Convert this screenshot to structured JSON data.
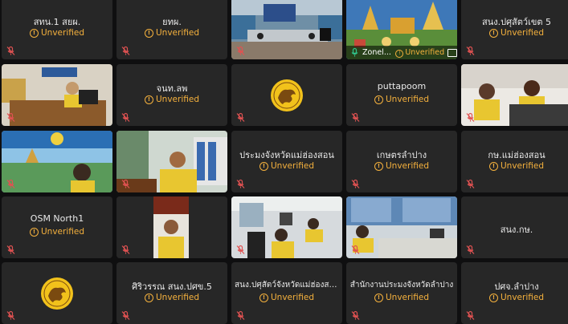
{
  "status_label": "Unverified",
  "tiles": [
    {
      "name": "สทน.1 สยผ.",
      "type": "name"
    },
    {
      "name": "ยทผ.",
      "type": "name"
    },
    {
      "name": "",
      "type": "video"
    },
    {
      "name": "Zonel...",
      "type": "video-label",
      "active": true
    },
    {
      "name": "สนง.ปศุสัตว์เขต 5",
      "type": "name"
    },
    {
      "name": "",
      "type": "video"
    },
    {
      "name": "จนท.ลพ",
      "type": "name"
    },
    {
      "name": "",
      "type": "logo"
    },
    {
      "name": "puttapoom",
      "type": "name"
    },
    {
      "name": "",
      "type": "video"
    },
    {
      "name": "",
      "type": "video"
    },
    {
      "name": "",
      "type": "video"
    },
    {
      "name": "ประมงจังหวัดแม่ฮ่องสอน",
      "type": "name"
    },
    {
      "name": "เกษตรลำปาง",
      "type": "name"
    },
    {
      "name": "กษ.แม่ฮ่องสอน",
      "type": "name"
    },
    {
      "name": "OSM North1",
      "type": "name"
    },
    {
      "name": "",
      "type": "video"
    },
    {
      "name": "",
      "type": "video"
    },
    {
      "name": "",
      "type": "video"
    },
    {
      "name": "สนง.กษ.",
      "type": "name-only"
    },
    {
      "name": "",
      "type": "logo"
    },
    {
      "name": "ศิริวรรณ สนง.ปศข.5",
      "type": "name"
    },
    {
      "name": "สนง.ปศุสัตว์จังหวัดแม่ฮ่องสอน",
      "type": "name"
    },
    {
      "name": "สำนักงานประมงจังหวัดลำปาง",
      "type": "name"
    },
    {
      "name": "ปศจ.ลำปาง",
      "type": "name"
    }
  ],
  "colors": {
    "tile_bg": "#272727",
    "unverified": "#f5b13d",
    "active_border": "#31c48d",
    "mute_icon": "#e05252"
  }
}
